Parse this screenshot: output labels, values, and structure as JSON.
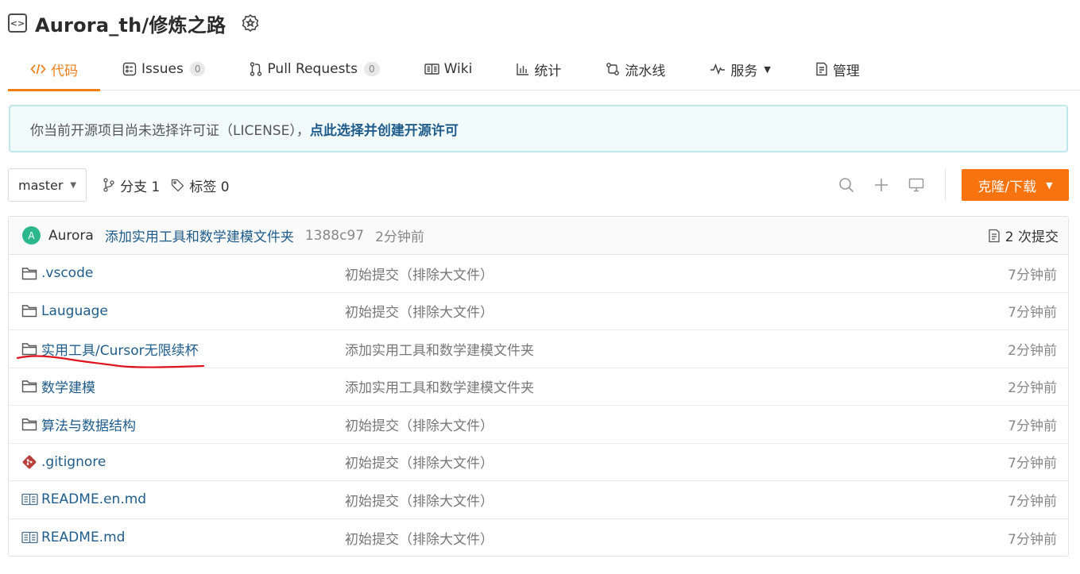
{
  "repo": {
    "title": "Aurora_th/修炼之路"
  },
  "tabs": [
    {
      "label": "代码",
      "icon": "code-icon",
      "active": true
    },
    {
      "label": "Issues",
      "icon": "issues-icon",
      "count": "0"
    },
    {
      "label": "Pull Requests",
      "icon": "pull-request-icon",
      "count": "0"
    },
    {
      "label": "Wiki",
      "icon": "book-icon"
    },
    {
      "label": "统计",
      "icon": "bar-chart-icon"
    },
    {
      "label": "流水线",
      "icon": "pipeline-icon"
    },
    {
      "label": "服务",
      "icon": "pulse-icon",
      "dropdown": true
    },
    {
      "label": "管理",
      "icon": "document-icon"
    }
  ],
  "notice": {
    "text": "你当前开源项目尚未选择许可证（LICENSE），",
    "link": "点此选择并创建开源许可"
  },
  "toolbar": {
    "branch": "master",
    "branches": "分支 1",
    "tags": "标签 0",
    "clone_label": "克隆/下载"
  },
  "commit": {
    "avatar_letter": "A",
    "author": "Aurora",
    "message": "添加实用工具和数学建模文件夹",
    "sha": "1388c97",
    "time": "2分钟前",
    "count_label": "2 次提交"
  },
  "files": [
    {
      "name": ".vscode",
      "type": "folder-icon",
      "message": "初始提交（排除大文件）",
      "time": "7分钟前"
    },
    {
      "name": "Lauguage",
      "type": "folder-icon",
      "message": "初始提交（排除大文件）",
      "time": "7分钟前"
    },
    {
      "name": "实用工具/Cursor无限续杯",
      "type": "folder-icon",
      "message": "添加实用工具和数学建模文件夹",
      "time": "2分钟前"
    },
    {
      "name": "数学建模",
      "type": "folder-icon",
      "message": "添加实用工具和数学建模文件夹",
      "time": "2分钟前"
    },
    {
      "name": "算法与数据结构",
      "type": "folder-icon",
      "message": "初始提交（排除大文件）",
      "time": "7分钟前"
    },
    {
      "name": ".gitignore",
      "type": "git-icon",
      "message": "初始提交（排除大文件）",
      "time": "7分钟前"
    },
    {
      "name": "README.en.md",
      "type": "readme-icon",
      "message": "初始提交（排除大文件）",
      "time": "7分钟前"
    },
    {
      "name": "README.md",
      "type": "readme-icon",
      "message": "初始提交（排除大文件）",
      "time": "7分钟前"
    }
  ],
  "colors": {
    "accent": "#f0801a",
    "clone_button": "#f8720e",
    "link": "#1f5c8b",
    "annotation": "#e0141e"
  }
}
